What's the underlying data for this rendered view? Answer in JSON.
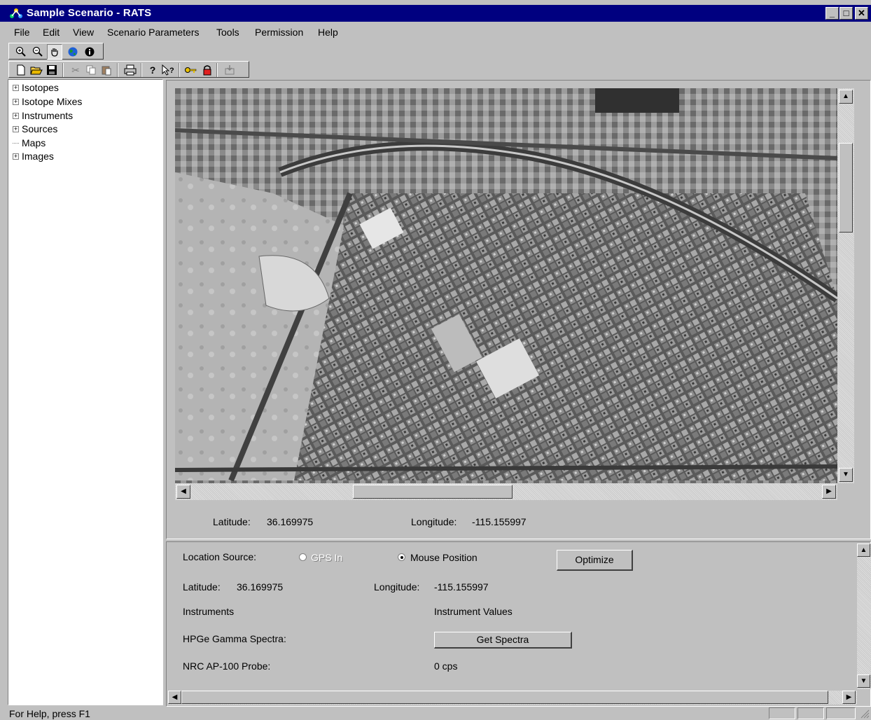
{
  "window": {
    "title": "Sample Scenario - RATS",
    "buttons": [
      "_",
      "□",
      "✕"
    ]
  },
  "menu": {
    "file": "File",
    "edit": "Edit",
    "view": "View",
    "scenario_parameters": "Scenario Parameters",
    "tools": "Tools",
    "permission": "Permission",
    "help": "Help"
  },
  "toolbar_map": {
    "icons": [
      "zoom-in-icon",
      "zoom-out-icon",
      "pan-hand-icon",
      "globe-icon",
      "info-icon"
    ]
  },
  "toolbar_main": {
    "icons": [
      "new-icon",
      "open-icon",
      "save-icon",
      "cut-icon",
      "copy-icon",
      "paste-icon",
      "print-icon",
      "help-icon",
      "context-help-icon",
      "key-icon",
      "lock-icon",
      "import-icon"
    ]
  },
  "tree": {
    "items": [
      {
        "label": "Isotopes",
        "expandable": true
      },
      {
        "label": "Isotope Mixes",
        "expandable": true
      },
      {
        "label": "Instruments",
        "expandable": true
      },
      {
        "label": "Sources",
        "expandable": true
      },
      {
        "label": "Maps",
        "expandable": false
      },
      {
        "label": "Images",
        "expandable": true
      }
    ]
  },
  "map": {
    "latitude_label": "Latitude:",
    "latitude_value": "36.169975",
    "longitude_label": "Longitude:",
    "longitude_value": "-115.155997"
  },
  "info": {
    "location_source_label": "Location Source:",
    "gps_in_label": "GPS In",
    "mouse_position_label": "Mouse Position",
    "optimize_label": "Optimize",
    "latitude_label": "Latitude:",
    "latitude_value": "36.169975",
    "longitude_label": "Longitude:",
    "longitude_value": "-115.155997",
    "instruments_header": "Instruments",
    "instrument_values_header": "Instrument Values",
    "hpge_label": "HPGe Gamma Spectra:",
    "get_spectra_label": "Get Spectra",
    "nrc_label": "NRC AP-100 Probe:",
    "nrc_value": "0 cps"
  },
  "status": {
    "text": "For Help, press F1"
  }
}
